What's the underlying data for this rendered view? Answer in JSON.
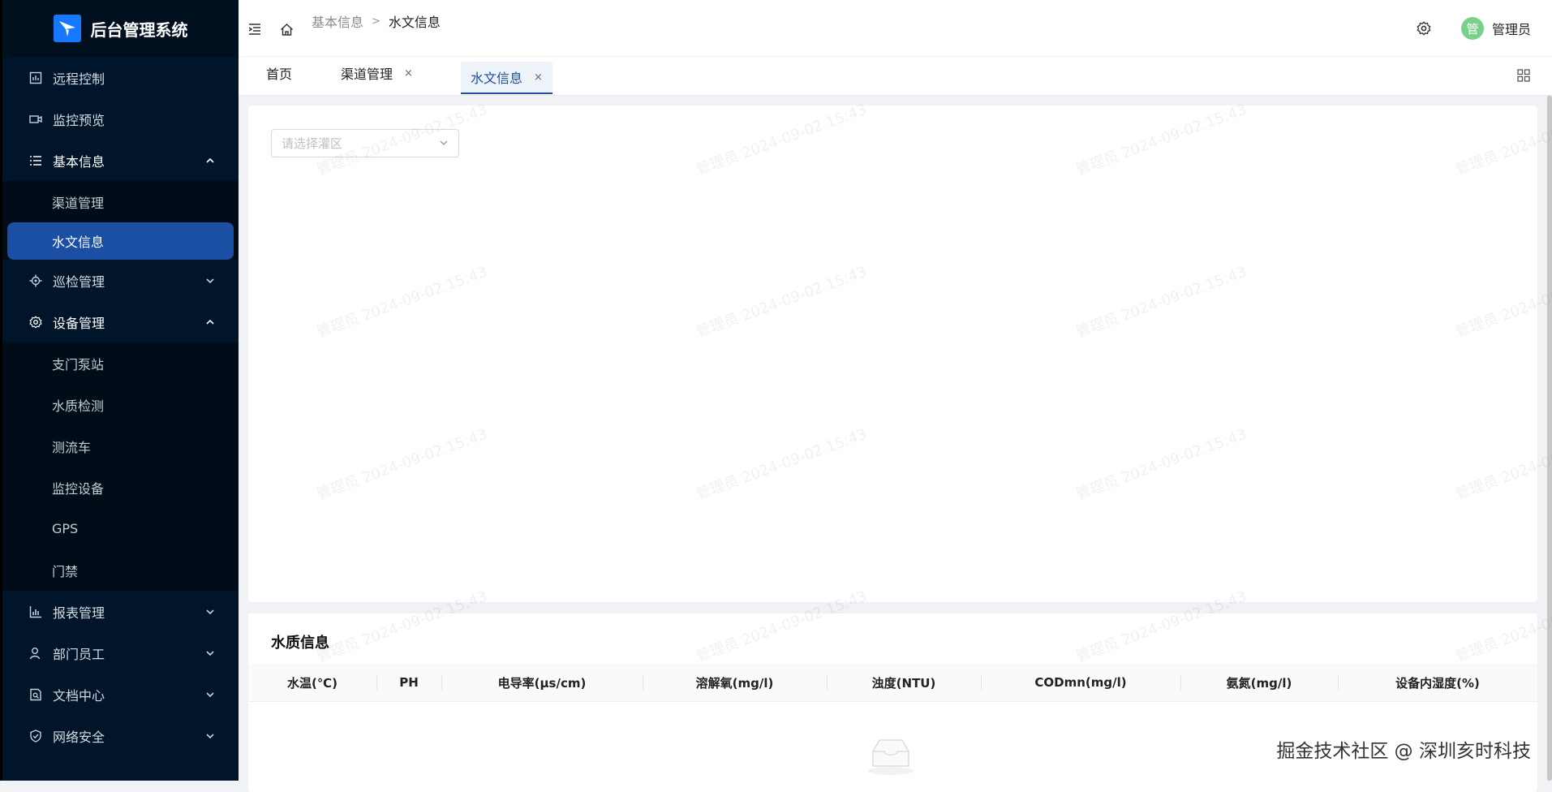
{
  "app": {
    "title": "后台管理系统"
  },
  "sidebar": {
    "items": [
      {
        "label": "远程控制",
        "icon": "remote-control-icon"
      },
      {
        "label": "监控预览",
        "icon": "video-camera-icon"
      },
      {
        "label": "基本信息",
        "icon": "list-icon",
        "expanded": true,
        "children": [
          {
            "label": "渠道管理"
          },
          {
            "label": "水文信息",
            "active": true
          }
        ]
      },
      {
        "label": "巡检管理",
        "icon": "target-icon"
      },
      {
        "label": "设备管理",
        "icon": "gear-icon",
        "expanded": true,
        "children": [
          {
            "label": "支门泵站"
          },
          {
            "label": "水质检测"
          },
          {
            "label": "测流车"
          },
          {
            "label": "监控设备"
          },
          {
            "label": "GPS"
          },
          {
            "label": "门禁"
          }
        ]
      },
      {
        "label": "报表管理",
        "icon": "bar-chart-icon"
      },
      {
        "label": "部门员工",
        "icon": "user-icon"
      },
      {
        "label": "文档中心",
        "icon": "document-icon"
      },
      {
        "label": "网络安全",
        "icon": "shield-icon"
      }
    ]
  },
  "header": {
    "breadcrumb": [
      "基本信息",
      "水文信息"
    ],
    "breadcrumb_separator": ">",
    "user": {
      "avatar_text": "管",
      "name": "管理员"
    }
  },
  "tabs": [
    {
      "label": "首页",
      "closable": false
    },
    {
      "label": "渠道管理",
      "closable": true
    },
    {
      "label": "水文信息",
      "closable": true,
      "active": true
    }
  ],
  "tab_close_glyph": "×",
  "filter": {
    "placeholder": "请选择灌区"
  },
  "water_quality": {
    "title": "水质信息",
    "columns": [
      "水温(℃)",
      "PH",
      "电导率(μs/cm)",
      "溶解氧(mg/l)",
      "浊度(NTU)",
      "CODmn(mg/l)",
      "氨氮(mg/l)",
      "设备内湿度(%)"
    ],
    "rows": []
  },
  "watermark": {
    "text": "管理员 2024-09-02 15:43"
  },
  "credit": "掘金技术社区 @ 深圳亥时科技",
  "colors": {
    "sidebar_bg": "#001529",
    "active_bg": "#1a4fa3",
    "accent": "#1677ff",
    "avatar": "#7ad08a"
  }
}
